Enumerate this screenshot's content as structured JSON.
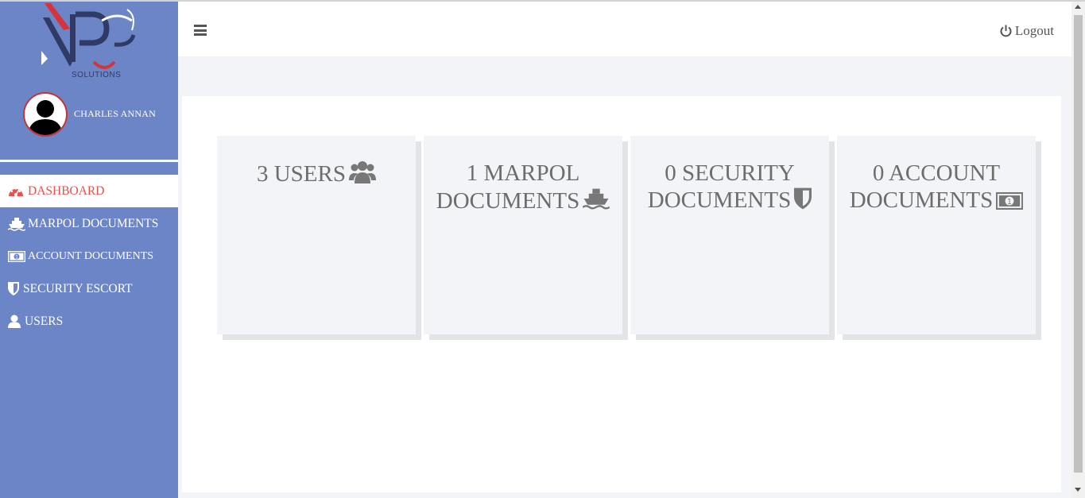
{
  "brand": {
    "logo_text": "SOLUTIONS",
    "colors": {
      "sidebar": "#6b85c7",
      "accent": "#e84f4f",
      "navy": "#2f3a66"
    }
  },
  "user": {
    "name": "CHARLES ANNAN"
  },
  "header": {
    "logout_label": "Logout"
  },
  "nav": [
    {
      "label": "DASHBOARD",
      "icon": "dashboard-gauge-icon",
      "active": true
    },
    {
      "label": "MARPOL DOCUMENTS",
      "icon": "ship-icon",
      "active": false
    },
    {
      "label": "ACCOUNT DOCUMENTS",
      "icon": "money-icon",
      "active": false
    },
    {
      "label": "SECURITY ESCORT",
      "icon": "shield-icon",
      "active": false
    },
    {
      "label": "USERS",
      "icon": "user-icon",
      "active": false
    }
  ],
  "cards": [
    {
      "line1": "3 USERS",
      "line2": "",
      "icon": "users-icon"
    },
    {
      "line1": "1 MARPOL",
      "line2": "DOCUMENTS",
      "icon": "ship-icon"
    },
    {
      "line1": "0 SECURITY",
      "line2": "DOCUMENTS",
      "icon": "shield-icon"
    },
    {
      "line1": "0 ACCOUNT",
      "line2": "DOCUMENTS",
      "icon": "money-icon"
    }
  ]
}
